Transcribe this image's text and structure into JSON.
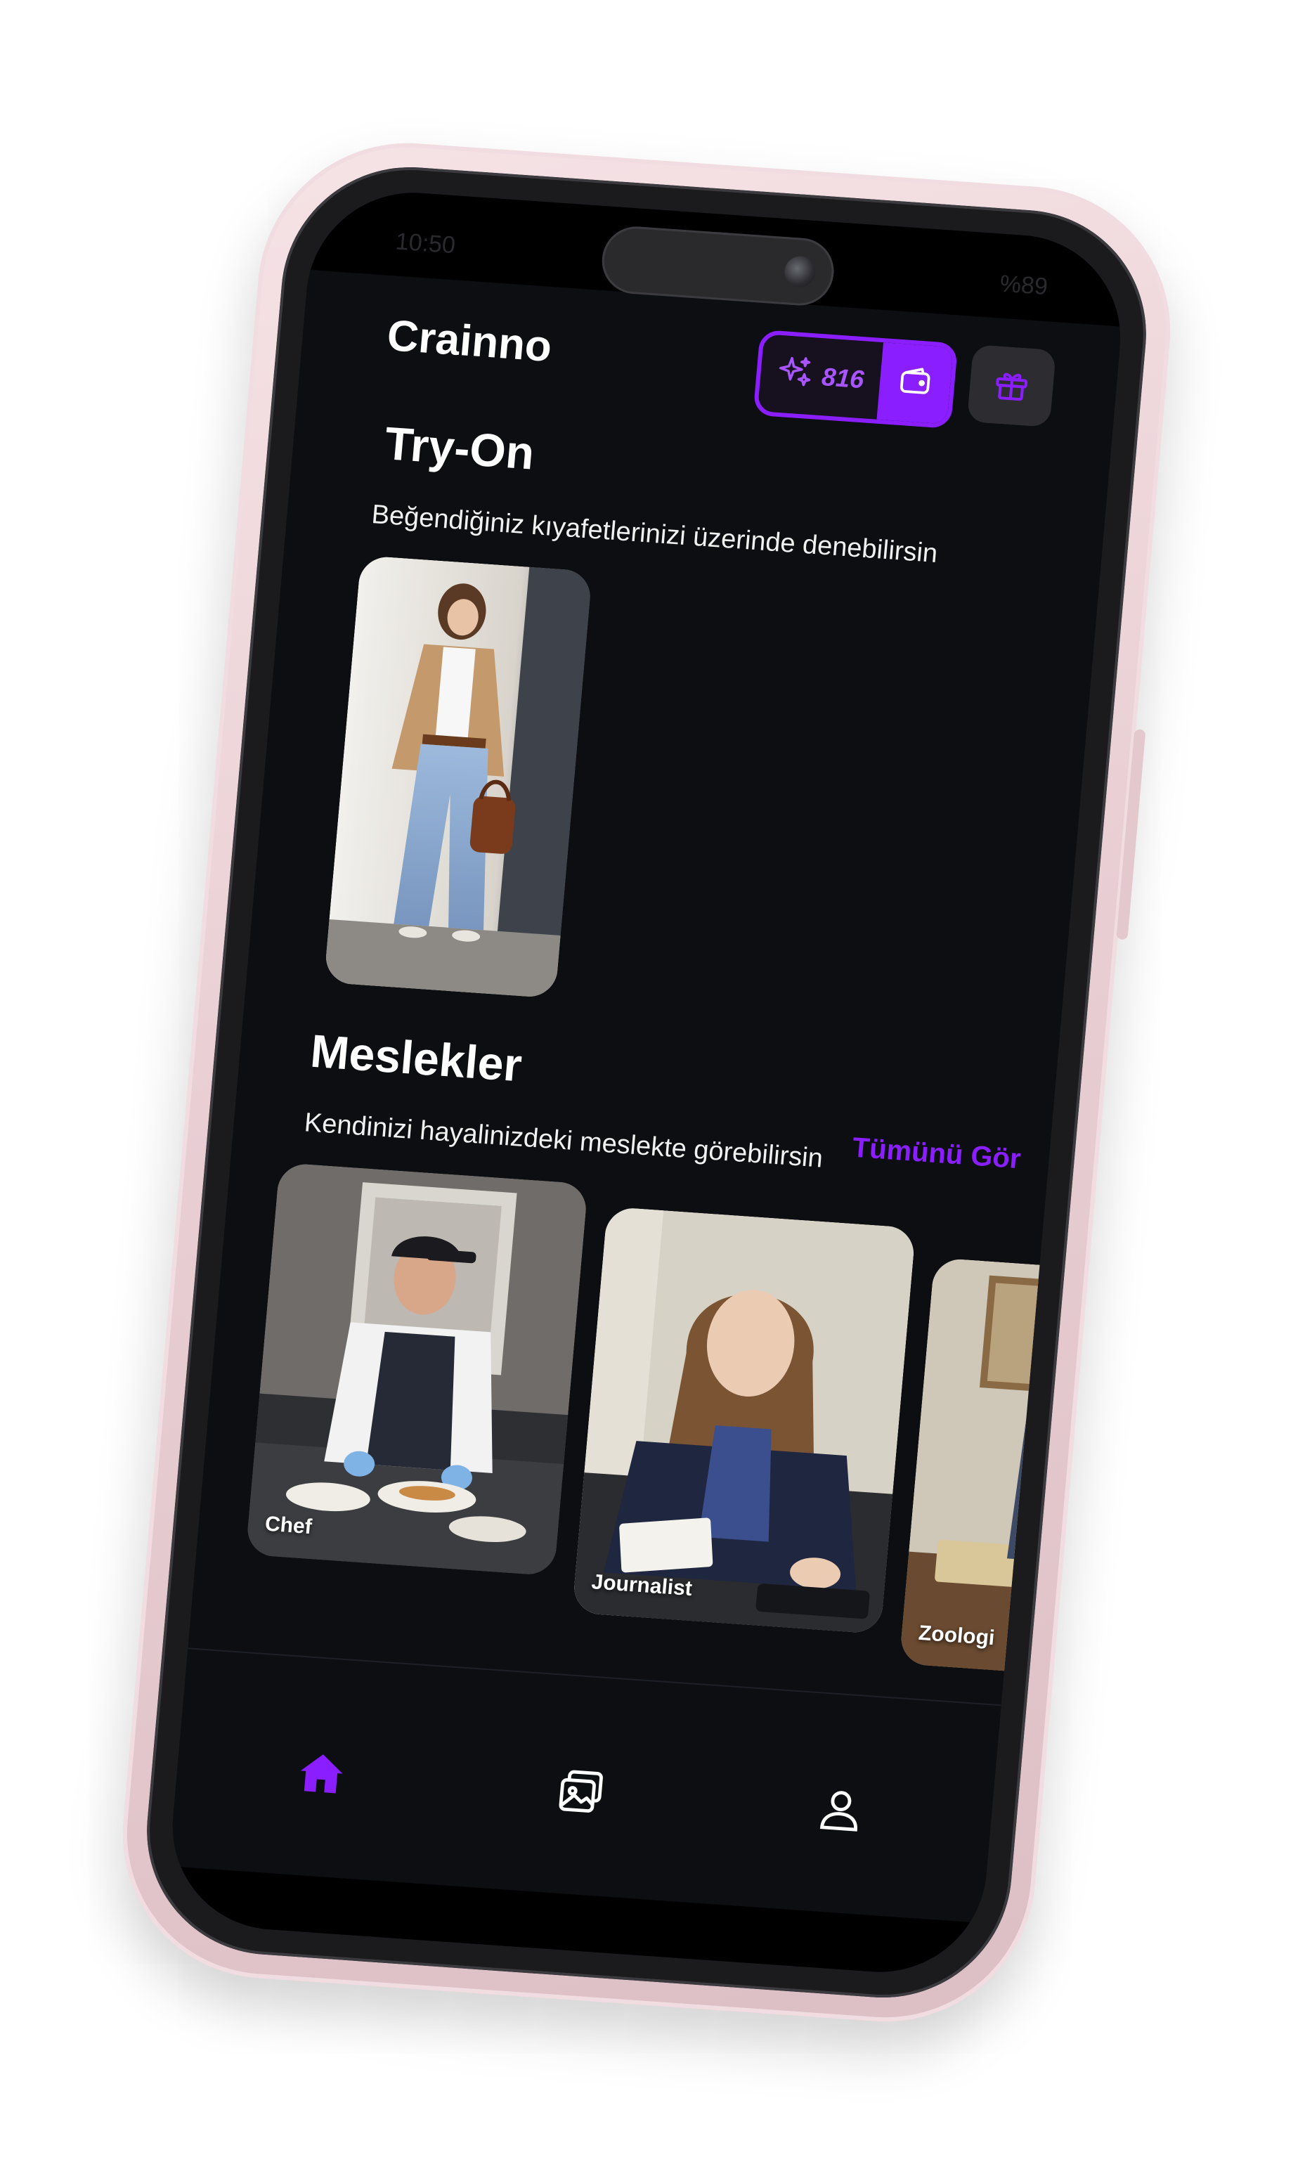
{
  "status_bar": {
    "time": "10:50",
    "battery": "%89"
  },
  "header": {
    "app_title": "Crainno",
    "credits": "816",
    "credit_icon": "sparkles-icon",
    "wallet_icon": "wallet-icon",
    "gift_icon": "gift-icon"
  },
  "try_on": {
    "title": "Try-On",
    "subtitle": "Beğendiğiniz kıyafetlerinizi üzerinde denebilirsin"
  },
  "professions": {
    "title": "Meslekler",
    "subtitle": "Kendinizi hayalinizdeki meslekte görebilirsin",
    "see_all": "Tümünü Gör",
    "cards": [
      {
        "label": "Chef"
      },
      {
        "label": "Journalist"
      },
      {
        "label": "Zoologi"
      }
    ]
  },
  "bottom_nav": {
    "items": [
      {
        "icon": "home-icon",
        "active": true
      },
      {
        "icon": "gallery-icon",
        "active": false
      },
      {
        "icon": "profile-icon",
        "active": false
      }
    ]
  },
  "colors": {
    "accent": "#8a1eff",
    "background": "#0c0e12",
    "case": "#ebd3d8"
  }
}
